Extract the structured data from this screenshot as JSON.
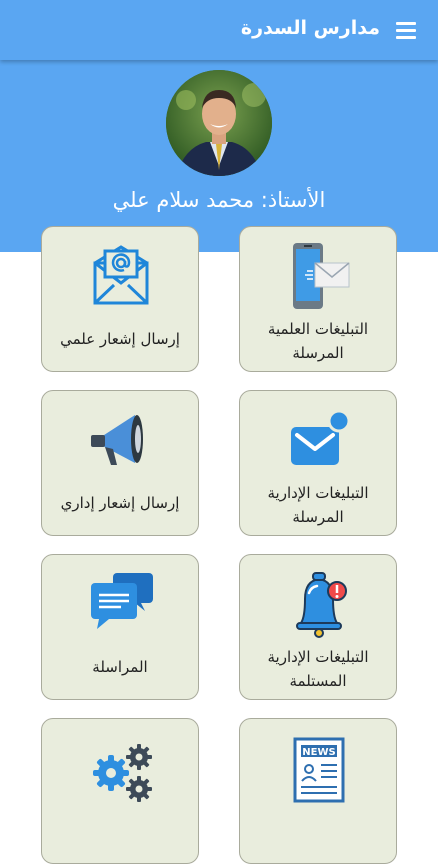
{
  "app": {
    "title": "مدارس السدرة",
    "menu_icon": "hamburger-menu-icon"
  },
  "header": {
    "teacher_name": "الأستاذ: محمد سلام علي",
    "background_color": "#5aa6f2"
  },
  "cards": [
    {
      "label": "إرسال إشعار علمي",
      "icon": "email-at-icon"
    },
    {
      "label": "التبليغات العلمية المرسلة",
      "icon": "phone-message-icon"
    },
    {
      "label": "إرسال إشعار إداري",
      "icon": "megaphone-icon"
    },
    {
      "label": "التبليغات الإدارية المرسلة",
      "icon": "mail-notification-icon"
    },
    {
      "label": "المراسلة",
      "icon": "chat-bubbles-icon"
    },
    {
      "label": "التبليغات الإدارية المستلمة",
      "icon": "bell-alert-icon"
    },
    {
      "label": "",
      "icon": "gears-icon"
    },
    {
      "label": "",
      "icon": "news-icon"
    }
  ],
  "colors": {
    "card_background": "#e9eddd",
    "accent": "#2e8fe0"
  }
}
